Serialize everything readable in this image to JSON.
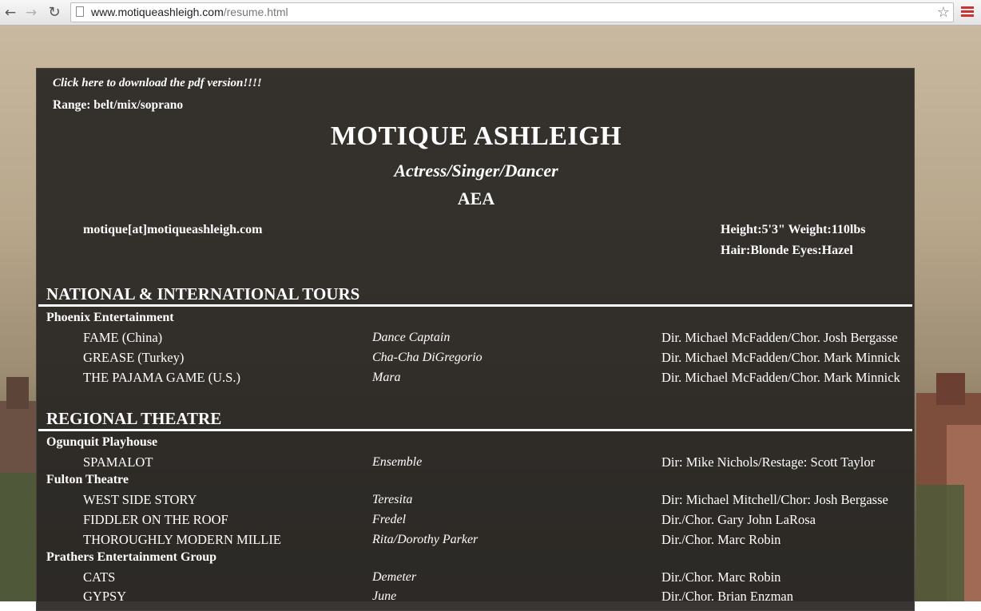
{
  "browser": {
    "url_domain": "www.motiqueashleigh.com",
    "url_path": "/resume.html"
  },
  "header": {
    "pdf_link": "Click here to download the pdf version!!!!",
    "range": "Range: belt/mix/soprano",
    "name": "MOTIQUE ASHLEIGH",
    "tagline": "Actress/Singer/Dancer",
    "union": "AEA",
    "email": "motique[at]motiqueashleigh.com",
    "stats_line1": "Height:5'3\"  Weight:110lbs",
    "stats_line2": "Hair:Blonde Eyes:Hazel"
  },
  "sections": [
    {
      "title": "NATIONAL & INTERNATIONAL TOURS",
      "companies": [
        {
          "name": "Phoenix Entertainment",
          "credits": [
            {
              "show": "FAME (China)",
              "role": "Dance Captain",
              "credit": "Dir. Michael McFadden/Chor. Josh Bergasse"
            },
            {
              "show": "GREASE (Turkey)",
              "role": "Cha-Cha DiGregorio",
              "credit": "Dir. Michael McFadden/Chor. Mark Minnick"
            },
            {
              "show": "THE PAJAMA GAME (U.S.)",
              "role": "Mara",
              "credit": "Dir. Michael McFadden/Chor. Mark Minnick"
            }
          ]
        }
      ]
    },
    {
      "title": "REGIONAL THEATRE",
      "companies": [
        {
          "name": "Ogunquit Playhouse",
          "credits": [
            {
              "show": "SPAMALOT",
              "role": "Ensemble",
              "credit": "Dir: Mike Nichols/Restage: Scott Taylor"
            }
          ]
        },
        {
          "name": "Fulton Theatre",
          "credits": [
            {
              "show": "WEST SIDE STORY",
              "role": "Teresita",
              "credit": "Dir: Michael Mitchell/Chor: Josh Bergasse"
            },
            {
              "show": "FIDDLER ON THE ROOF",
              "role": "Fredel",
              "credit": "Dir./Chor. Gary John LaRosa"
            },
            {
              "show": "THOROUGHLY MODERN MILLIE",
              "role": "Rita/Dorothy Parker",
              "credit": "Dir./Chor. Marc Robin"
            }
          ]
        },
        {
          "name": "Prathers Entertainment Group",
          "credits": [
            {
              "show": "CATS",
              "role": "Demeter",
              "credit": "Dir./Chor. Marc Robin"
            },
            {
              "show": "GYPSY",
              "role": "June",
              "credit": "Dir./Chor. Brian Enzman"
            }
          ]
        }
      ]
    }
  ]
}
